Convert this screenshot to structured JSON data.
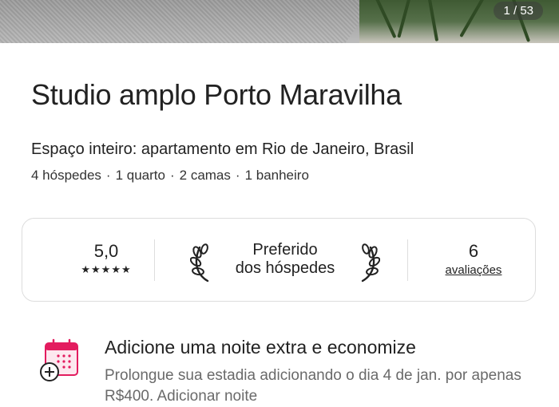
{
  "photo": {
    "counter": "1 / 53"
  },
  "listing": {
    "title": "Studio amplo Porto Maravilha",
    "subtitle": "Espaço inteiro: apartamento em Rio de Janeiro, Brasil",
    "details": [
      "4 hóspedes",
      "1 quarto",
      "2 camas",
      "1 banheiro"
    ]
  },
  "rating_card": {
    "score": "5,0",
    "stars": "★★★★★",
    "badge_line1": "Preferido",
    "badge_line2": "dos hóspedes",
    "reviews_count": "6",
    "reviews_label": "avaliações"
  },
  "promo": {
    "heading": "Adicione uma noite extra e economize",
    "body": "Prolongue sua estadia adicionando o dia 4 de jan. por apenas R$400. Adicionar noite"
  },
  "colors": {
    "text": "#222222",
    "muted": "#6a6a6a",
    "border": "#dddddd",
    "calendar_accent": "#e31c5f"
  },
  "icons": {
    "badge": "laurel-icon",
    "promo": "calendar-plus-icon"
  }
}
